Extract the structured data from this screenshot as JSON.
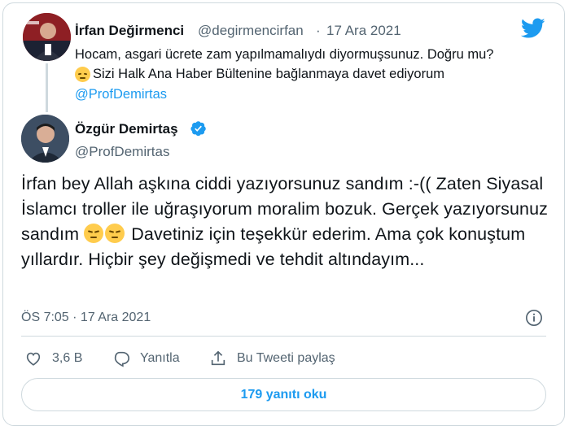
{
  "reply_tweet": {
    "author_name": "İrfan Değirmenci",
    "handle": "@degirmencirfan",
    "separator": "·",
    "date": "17 Ara 2021",
    "line1": "Hocam, asgari ücrete zam yapılmamalıydı diyormuşsunuz. Doğru mu?",
    "line2": "Sizi Halk Ana Haber Bültenine bağlanmaya davet ediyorum",
    "mention": "@ProfDemirtas"
  },
  "main_tweet": {
    "author_name": "Özgür Demirtaş",
    "handle": "@ProfDemirtas",
    "text_part1": "İrfan bey Allah aşkına ciddi yazıyorsunuz sandım :-(( Zaten Siyasal İslamcı troller ile uğraşıyorum moralim bozuk. Gerçek yazıyorsunuz sandım ",
    "text_part2": " Davetiniz için teşekkür ederim. Ama çok konuştum yıllardır. Hiçbir şey değişmedi ve tehdit altındayım...",
    "timestamp": "ÖS 7:05 · 17 Ara 2021"
  },
  "actions": {
    "like_count": "3,6 B",
    "reply_label": "Yanıtla",
    "share_label": "Bu Tweeti paylaş"
  },
  "read_replies_label": "179 yanıtı oku",
  "colors": {
    "accent": "#1d9bf0",
    "muted": "#536471",
    "border": "#cfd9de"
  },
  "icons": [
    "twitter-bird-icon",
    "verified-badge-icon",
    "info-icon",
    "heart-icon",
    "reply-bubble-icon",
    "share-icon",
    "pensive-face-emoji",
    "confused-face-emoji"
  ]
}
